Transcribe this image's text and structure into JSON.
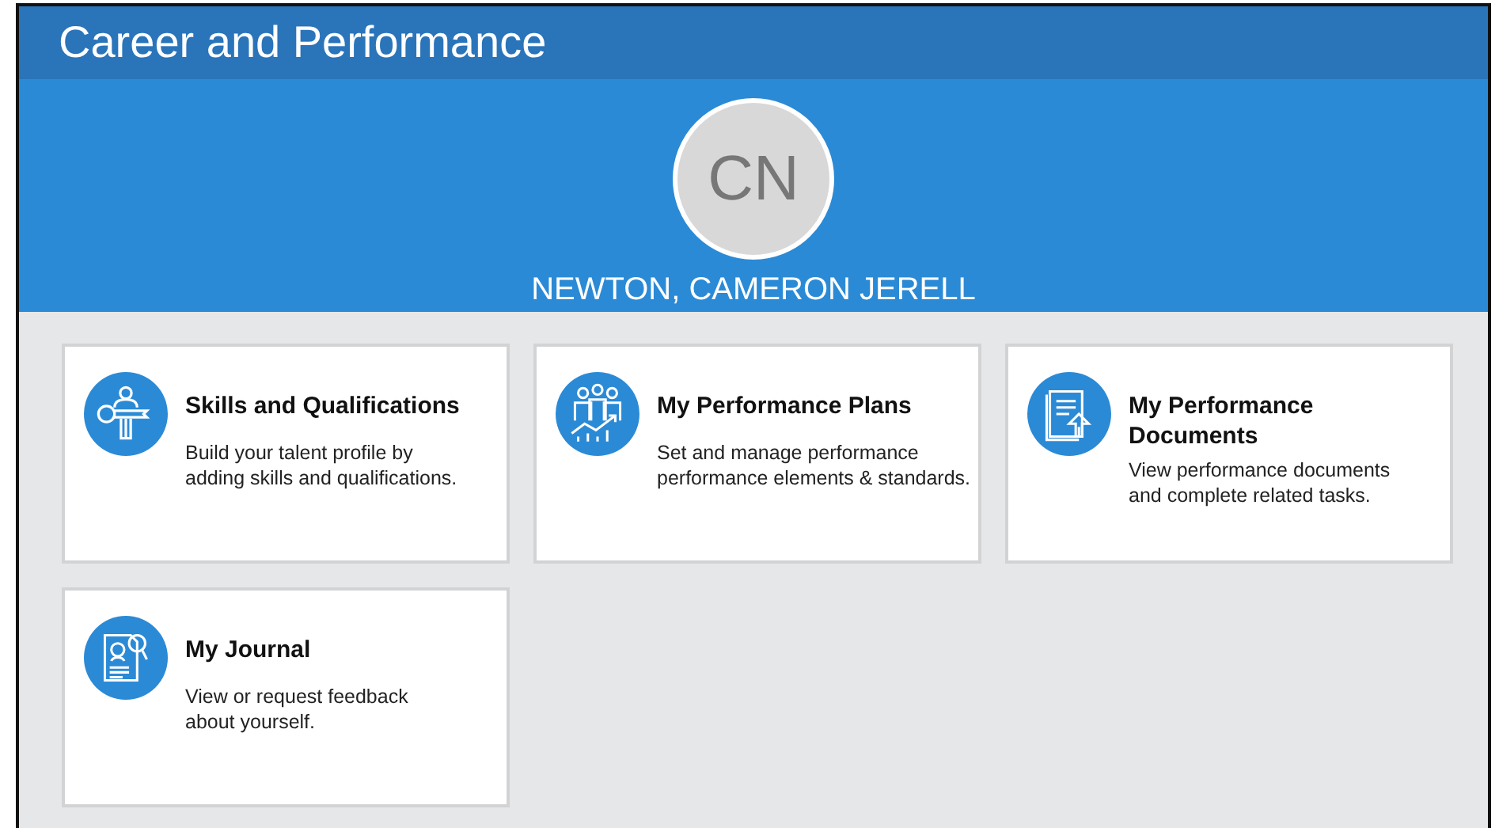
{
  "header": {
    "title": "Career and Performance"
  },
  "profile": {
    "initials": "CN",
    "name": "NEWTON, CAMERON JERELL"
  },
  "cards": [
    {
      "title": "Skills and Qualifications",
      "description": "Build your talent profile by\nadding skills and qualifications."
    },
    {
      "title": "My Performance Plans",
      "description": "Set and manage performance\nperformance elements & standards."
    },
    {
      "title": "My Performance\nDocuments",
      "description": "View performance documents\nand complete related tasks."
    },
    {
      "title": "My Journal",
      "description": "View or request feedback\nabout yourself."
    }
  ]
}
